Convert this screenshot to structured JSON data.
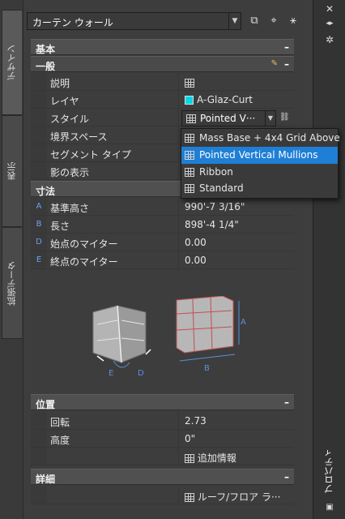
{
  "palette": {
    "title": "プロパティ",
    "left_tabs": [
      {
        "label": "デザイン",
        "active": true
      },
      {
        "label": "表示",
        "active": false
      },
      {
        "label": "拡張データ",
        "active": false
      }
    ]
  },
  "header": {
    "type_value": "カーテン ウォール"
  },
  "sections": {
    "basic": {
      "label": "基本",
      "collapse": "–"
    },
    "general": {
      "label": "一般",
      "collapse": "–",
      "rows": [
        {
          "name": "説明",
          "value": ""
        },
        {
          "name": "レイヤ",
          "value": "A-Glaz-Curt"
        },
        {
          "name": "スタイル",
          "value": "Pointed V···"
        },
        {
          "name": "境界スペース",
          "value": ""
        },
        {
          "name": "セグメント タイプ",
          "value": ""
        },
        {
          "name": "影の表示",
          "value": ""
        }
      ]
    },
    "dimensions": {
      "label": "寸法",
      "rows": [
        {
          "key": "A",
          "name": "基準高さ",
          "value": "990'-7 3/16\""
        },
        {
          "key": "B",
          "name": "長さ",
          "value": "898'-4 1/4\""
        },
        {
          "key": "D",
          "name": "始点のマイター",
          "value": "0.00"
        },
        {
          "key": "E",
          "name": "終点のマイター",
          "value": "0.00"
        }
      ],
      "figure_labels": {
        "a": "A",
        "b": "B",
        "d": "D",
        "e": "E"
      }
    },
    "location": {
      "label": "位置",
      "collapse": "–",
      "rows": [
        {
          "name": "回転",
          "value": "2.73"
        },
        {
          "name": "高度",
          "value": "0\""
        },
        {
          "name": "",
          "value": "追加情報"
        }
      ]
    },
    "details": {
      "label": "詳細",
      "collapse": "–",
      "rows": [
        {
          "name": "",
          "value": "ルーフ/フロア ラ···"
        }
      ]
    }
  },
  "style_dropdown": {
    "options": [
      {
        "label": "Mass Base + 4x4 Grid Above",
        "selected": false
      },
      {
        "label": "Pointed Vertical Mullions",
        "selected": true
      },
      {
        "label": "Ribbon",
        "selected": false
      },
      {
        "label": "Standard",
        "selected": false
      }
    ]
  },
  "colors": {
    "accent": "#1f7fd6",
    "layer_swatch": "#00d8e8",
    "dimension_blue": "#5b8fe0"
  }
}
